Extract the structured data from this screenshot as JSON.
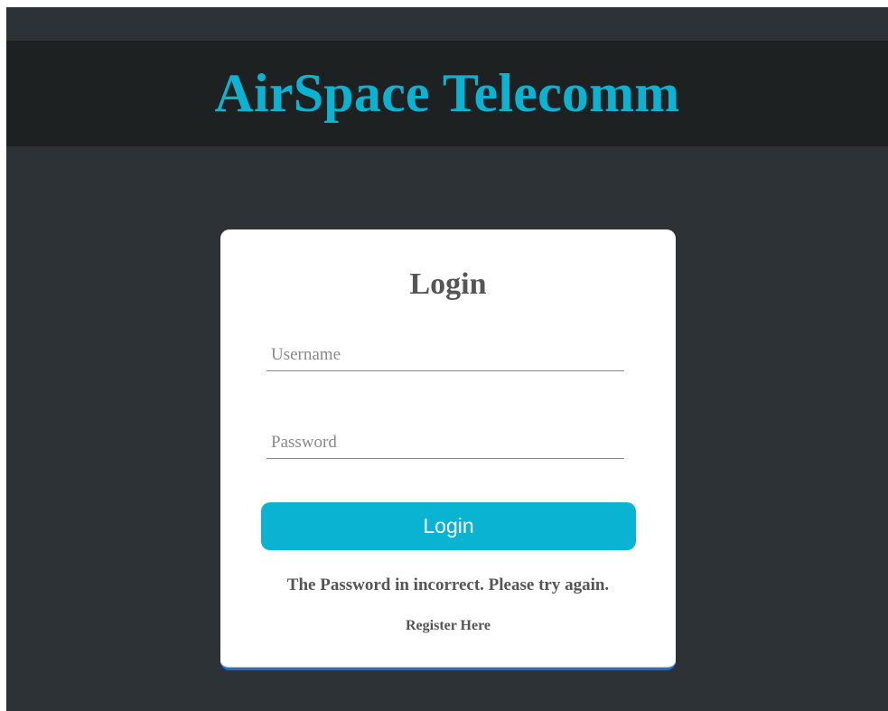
{
  "header": {
    "brand": "AirSpace Telecomm"
  },
  "login_card": {
    "title": "Login",
    "username": {
      "value": "",
      "placeholder": "Username"
    },
    "password": {
      "value": "",
      "placeholder": "Password"
    },
    "login_button_label": "Login",
    "error_message": "The Password in incorrect. Please try again.",
    "register_link": "Register Here"
  },
  "colors": {
    "accent": "#0ab3d1",
    "background": "#2c3235",
    "header_background": "#1e2122",
    "card_background": "#ffffff",
    "card_bottom_border": "#1f6fd0",
    "text": "#555555"
  }
}
